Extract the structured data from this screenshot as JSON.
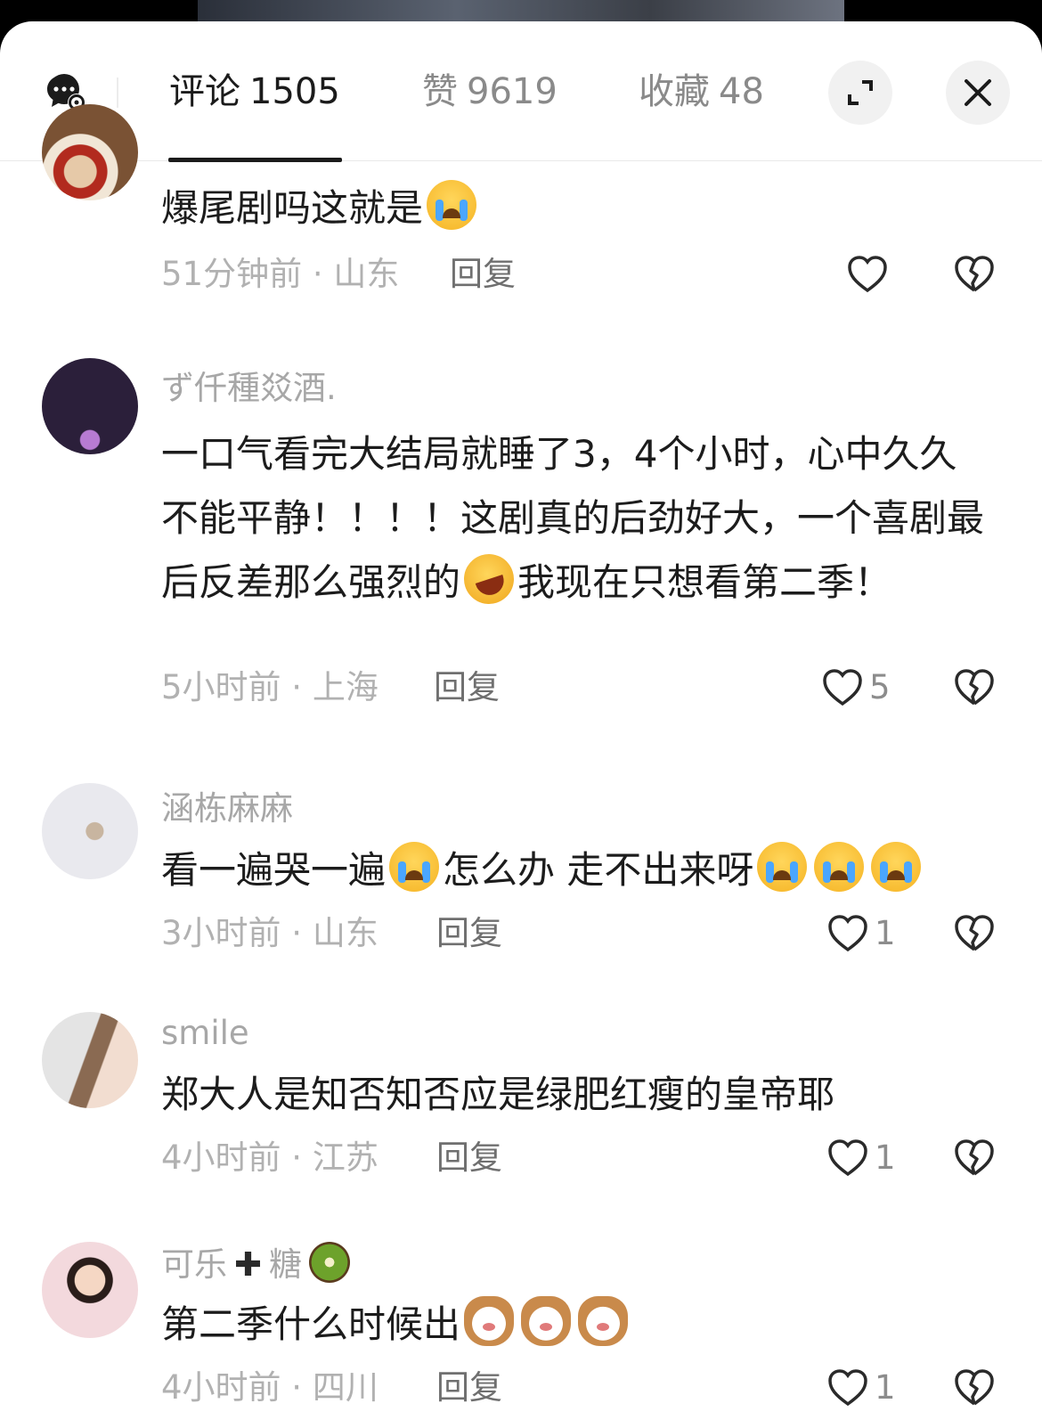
{
  "header": {
    "tabs": [
      {
        "label": "评论",
        "count": "1505"
      },
      {
        "label": "赞",
        "count": "9619"
      },
      {
        "label": "收藏",
        "count": "48"
      }
    ]
  },
  "comments": [
    {
      "username": "",
      "text": "爆尾剧吗这就是",
      "time": "51分钟前",
      "location": "山东",
      "reply_label": "回复",
      "likes": ""
    },
    {
      "username": "ず仟種㸚酒.",
      "text_part1": "一口气看完大结局就睡了3，4个小时，心中久久不能平静！！！！这剧真的后劲好大，一个喜剧最后反差那么强烈的",
      "text_part2": "我现在只想看第二季！",
      "time": "5小时前",
      "location": "上海",
      "reply_label": "回复",
      "likes": "5"
    },
    {
      "username": "涵栋麻麻",
      "text_part1": "看一遍哭一遍",
      "text_part2": "怎么办 走不出来呀",
      "time": "3小时前",
      "location": "山东",
      "reply_label": "回复",
      "likes": "1"
    },
    {
      "username": "smile",
      "text": "郑大人是知否知否应是绿肥红瘦的皇帝耶",
      "time": "4小时前",
      "location": "江苏",
      "reply_label": "回复",
      "likes": "1"
    },
    {
      "username_part1": "可乐",
      "username_plus": "✚",
      "username_part2": "糖",
      "text": "第二季什么时候出",
      "time": "4小时前",
      "location": "四川",
      "reply_label": "回复",
      "likes": "1"
    }
  ],
  "meta_separator": " · ",
  "icons": [
    "chat-settings-icon",
    "expand-icon",
    "close-icon",
    "heart-icon",
    "broken-heart-icon",
    "crying-emoji",
    "rofl-emoji",
    "cat-emoji",
    "kiwi-emoji"
  ]
}
